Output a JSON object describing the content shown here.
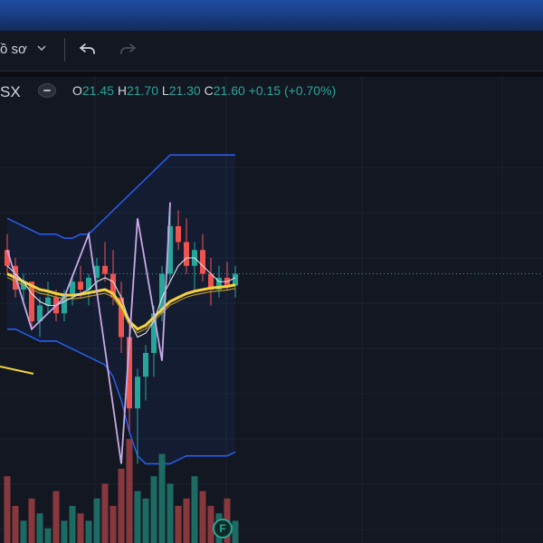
{
  "toolbar": {
    "profile_label": "ồ sơ",
    "chevron_icon": "chevron-down-icon",
    "undo_icon": "undo-icon",
    "redo_icon": "redo-icon"
  },
  "legend": {
    "symbol_suffix": "SX",
    "o_label": "O",
    "o_value": "21.45",
    "h_label": "H",
    "h_value": "21.70",
    "l_label": "L",
    "l_value": "21.30",
    "c_label": "C",
    "c_value": "21.60",
    "change": "+0.15 (+0.70%)"
  },
  "marker": {
    "label": "F"
  },
  "colors": {
    "up": "#26a69a",
    "down": "#ef5350",
    "bollinger": "#2962ff",
    "ma_yellow": "#f5d33b",
    "zigzag": "#c9a9e6",
    "background": "#131722"
  },
  "chart_data": {
    "type": "candlestick",
    "candles": [
      {
        "o": 21.9,
        "h": 22.1,
        "l": 21.6,
        "c": 21.7
      },
      {
        "o": 21.7,
        "h": 21.8,
        "l": 21.3,
        "c": 21.4
      },
      {
        "o": 21.4,
        "h": 21.6,
        "l": 21.2,
        "c": 21.5
      },
      {
        "o": 21.5,
        "h": 21.5,
        "l": 20.9,
        "c": 21.0
      },
      {
        "o": 21.0,
        "h": 21.3,
        "l": 20.8,
        "c": 21.2
      },
      {
        "o": 21.2,
        "h": 21.5,
        "l": 21.1,
        "c": 21.3
      },
      {
        "o": 21.3,
        "h": 21.4,
        "l": 21.0,
        "c": 21.1
      },
      {
        "o": 21.1,
        "h": 21.4,
        "l": 21.0,
        "c": 21.35
      },
      {
        "o": 21.35,
        "h": 21.6,
        "l": 21.2,
        "c": 21.5
      },
      {
        "o": 21.5,
        "h": 21.7,
        "l": 21.3,
        "c": 21.4
      },
      {
        "o": 21.4,
        "h": 21.6,
        "l": 21.2,
        "c": 21.55
      },
      {
        "o": 21.55,
        "h": 21.8,
        "l": 21.4,
        "c": 21.7
      },
      {
        "o": 21.7,
        "h": 22.0,
        "l": 21.5,
        "c": 21.6
      },
      {
        "o": 21.6,
        "h": 21.9,
        "l": 21.2,
        "c": 21.3
      },
      {
        "o": 21.3,
        "h": 21.5,
        "l": 20.6,
        "c": 20.8
      },
      {
        "o": 20.8,
        "h": 21.0,
        "l": 19.6,
        "c": 19.9
      },
      {
        "o": 19.9,
        "h": 20.4,
        "l": 19.2,
        "c": 20.3
      },
      {
        "o": 20.3,
        "h": 20.7,
        "l": 20.0,
        "c": 20.6
      },
      {
        "o": 20.6,
        "h": 21.2,
        "l": 20.3,
        "c": 21.1
      },
      {
        "o": 21.1,
        "h": 21.7,
        "l": 21.0,
        "c": 21.6
      },
      {
        "o": 21.6,
        "h": 22.5,
        "l": 21.5,
        "c": 22.2
      },
      {
        "o": 22.2,
        "h": 22.4,
        "l": 21.9,
        "c": 22.0
      },
      {
        "o": 22.0,
        "h": 22.3,
        "l": 21.6,
        "c": 21.7
      },
      {
        "o": 21.7,
        "h": 22.0,
        "l": 21.4,
        "c": 21.9
      },
      {
        "o": 21.9,
        "h": 22.1,
        "l": 21.5,
        "c": 21.6
      },
      {
        "o": 21.6,
        "h": 21.8,
        "l": 21.2,
        "c": 21.4
      },
      {
        "o": 21.4,
        "h": 21.7,
        "l": 21.3,
        "c": 21.55
      },
      {
        "o": 21.55,
        "h": 21.75,
        "l": 21.4,
        "c": 21.45
      },
      {
        "o": 21.45,
        "h": 21.7,
        "l": 21.3,
        "c": 21.6
      }
    ],
    "volume": [
      9,
      5,
      3,
      6,
      4,
      2,
      7,
      3,
      5,
      4,
      3,
      6,
      8,
      5,
      10,
      14,
      7,
      6,
      9,
      12,
      8,
      5,
      6,
      9,
      7,
      5,
      4,
      6,
      3
    ],
    "volume_up": [
      false,
      false,
      true,
      false,
      true,
      true,
      false,
      true,
      true,
      false,
      true,
      true,
      false,
      false,
      false,
      false,
      true,
      true,
      true,
      true,
      true,
      false,
      false,
      true,
      false,
      false,
      true,
      false,
      true
    ],
    "bollinger_upper": [
      22.3,
      22.25,
      22.2,
      22.15,
      22.1,
      22.1,
      22.1,
      22.05,
      22.05,
      22.1,
      22.1,
      22.2,
      22.3,
      22.4,
      22.5,
      22.6,
      22.7,
      22.8,
      22.9,
      23.0,
      23.1,
      23.1,
      23.1,
      23.1,
      23.1,
      23.1,
      23.1,
      23.1,
      23.1
    ],
    "bollinger_lower": [
      20.9,
      20.9,
      20.85,
      20.8,
      20.75,
      20.75,
      20.75,
      20.7,
      20.65,
      20.6,
      20.55,
      20.5,
      20.45,
      20.3,
      20.0,
      19.6,
      19.3,
      19.2,
      19.2,
      19.2,
      19.2,
      19.25,
      19.3,
      19.3,
      19.3,
      19.3,
      19.3,
      19.3,
      19.35
    ],
    "ma_yellow": [
      21.6,
      21.55,
      21.5,
      21.45,
      21.4,
      21.38,
      21.35,
      21.33,
      21.33,
      21.34,
      21.36,
      21.38,
      21.4,
      21.35,
      21.2,
      21.0,
      20.9,
      20.95,
      21.05,
      21.15,
      21.25,
      21.3,
      21.35,
      21.38,
      21.4,
      21.42,
      21.43,
      21.44,
      21.46
    ],
    "ma_white": [
      21.7,
      21.6,
      21.5,
      21.35,
      21.25,
      21.2,
      21.2,
      21.25,
      21.3,
      21.35,
      21.4,
      21.5,
      21.55,
      21.5,
      21.3,
      21.0,
      20.8,
      20.85,
      21.0,
      21.3,
      21.5,
      21.7,
      21.8,
      21.8,
      21.7,
      21.6,
      21.5,
      21.5,
      21.55
    ],
    "zigzag": [
      [
        0,
        21.9
      ],
      [
        3,
        20.9
      ],
      [
        7,
        21.3
      ],
      [
        10,
        22.1
      ],
      [
        14,
        19.2
      ],
      [
        16,
        22.3
      ],
      [
        19,
        20.5
      ],
      [
        20,
        22.5
      ]
    ],
    "price_line": 21.6
  }
}
